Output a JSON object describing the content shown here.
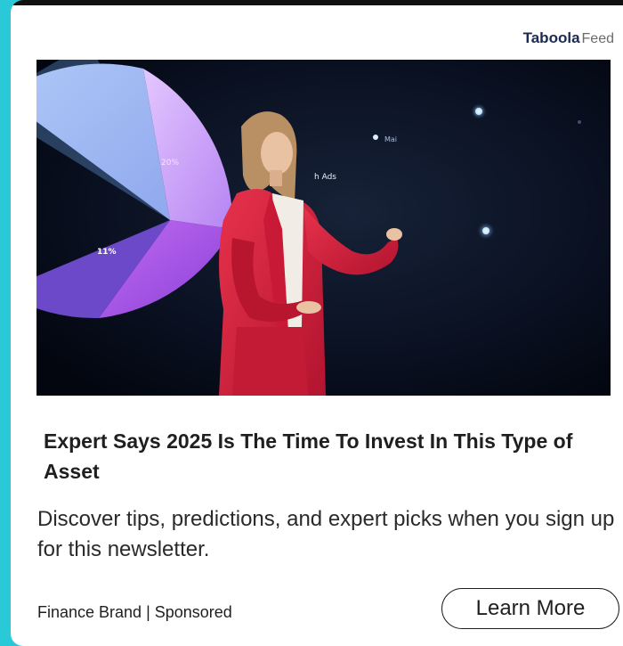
{
  "ad": {
    "network_name": "Taboola",
    "network_suffix": "Feed",
    "hero_labels": {
      "pie_label_1": "11%",
      "pie_label_2": "20%",
      "screen_label_1": "h Ads",
      "screen_label_2": "Mai"
    },
    "headline": "Expert Says 2025 Is The Time To Invest In This Type of Asset",
    "description": "Discover tips, predictions, and expert picks when you sign up for this newsletter.",
    "advertiser": "Finance Brand | Sponsored",
    "cta_label": "Learn More"
  },
  "colors": {
    "accent_cyan": "#2ac9d8",
    "brand_navy": "#1b2a52",
    "jacket_red": "#d3223f"
  }
}
